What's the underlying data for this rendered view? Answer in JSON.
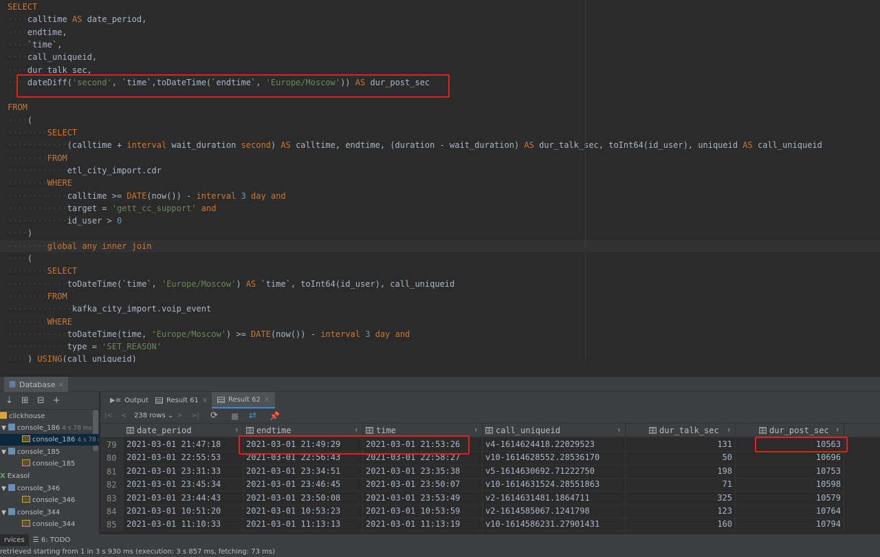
{
  "editor": {
    "lines": [
      [
        {
          "t": "SELECT",
          "c": "kw"
        }
      ],
      [
        {
          "t": "····",
          "c": "ws"
        },
        {
          "t": "calltime ",
          "c": "idt"
        },
        {
          "t": "AS",
          "c": "kw"
        },
        {
          "t": " date_period,",
          "c": "idt"
        }
      ],
      [
        {
          "t": "····",
          "c": "ws"
        },
        {
          "t": "endtime,",
          "c": "idt"
        }
      ],
      [
        {
          "t": "····",
          "c": "ws"
        },
        {
          "t": "`time`,",
          "c": "idt"
        }
      ],
      [
        {
          "t": "····",
          "c": "ws"
        },
        {
          "t": "call_uniqueid,",
          "c": "idt"
        }
      ],
      [
        {
          "t": "····",
          "c": "ws"
        },
        {
          "t": "dur_talk_sec,",
          "c": "idt"
        }
      ],
      [
        {
          "t": "····",
          "c": "ws"
        },
        {
          "t": "dateDiff(",
          "c": "idt"
        },
        {
          "t": "'second'",
          "c": "st"
        },
        {
          "t": ", `time`,toDateTime(`endtime`, ",
          "c": "idt"
        },
        {
          "t": "'Europe/Moscow'",
          "c": "st"
        },
        {
          "t": ")) ",
          "c": "idt"
        },
        {
          "t": "AS",
          "c": "kw"
        },
        {
          "t": " dur_post_sec",
          "c": "idt"
        }
      ],
      [],
      [
        {
          "t": "FROM",
          "c": "kw"
        }
      ],
      [
        {
          "t": "····",
          "c": "ws"
        },
        {
          "t": "(",
          "c": "idt"
        }
      ],
      [
        {
          "t": "········",
          "c": "ws"
        },
        {
          "t": "SELECT",
          "c": "kw"
        }
      ],
      [
        {
          "t": "············",
          "c": "ws"
        },
        {
          "t": "(calltime + ",
          "c": "idt"
        },
        {
          "t": "interval",
          "c": "kw"
        },
        {
          "t": " wait_duration ",
          "c": "idt"
        },
        {
          "t": "second",
          "c": "kw"
        },
        {
          "t": ") ",
          "c": "idt"
        },
        {
          "t": "AS",
          "c": "kw"
        },
        {
          "t": " calltime, endtime, (duration - wait_duration) ",
          "c": "idt"
        },
        {
          "t": "AS",
          "c": "kw"
        },
        {
          "t": " dur_talk_sec, toInt64(id_user), uniqueid ",
          "c": "idt"
        },
        {
          "t": "AS",
          "c": "kw"
        },
        {
          "t": " call_uniqueid",
          "c": "idt"
        }
      ],
      [
        {
          "t": "········",
          "c": "ws"
        },
        {
          "t": "FROM",
          "c": "kw"
        }
      ],
      [
        {
          "t": "············",
          "c": "ws"
        },
        {
          "t": "etl_city_import.cdr",
          "c": "idt"
        }
      ],
      [
        {
          "t": "········",
          "c": "ws"
        },
        {
          "t": "WHERE",
          "c": "kw"
        }
      ],
      [
        {
          "t": "············",
          "c": "ws"
        },
        {
          "t": "calltime >= ",
          "c": "idt"
        },
        {
          "t": "DATE",
          "c": "kw"
        },
        {
          "t": "(now()) - ",
          "c": "idt"
        },
        {
          "t": "interval",
          "c": "kw"
        },
        {
          "t": " ",
          "c": "idt"
        },
        {
          "t": "3",
          "c": "nm"
        },
        {
          "t": " ",
          "c": "idt"
        },
        {
          "t": "day",
          "c": "kw"
        },
        {
          "t": " ",
          "c": "idt"
        },
        {
          "t": "and",
          "c": "kw"
        }
      ],
      [
        {
          "t": "············",
          "c": "ws"
        },
        {
          "t": "target = ",
          "c": "idt"
        },
        {
          "t": "'gett_cc_support'",
          "c": "st"
        },
        {
          "t": " ",
          "c": "idt"
        },
        {
          "t": "and",
          "c": "kw"
        }
      ],
      [
        {
          "t": "············",
          "c": "ws"
        },
        {
          "t": "id_user > ",
          "c": "idt"
        },
        {
          "t": "0",
          "c": "nm"
        }
      ],
      [
        {
          "t": "····",
          "c": "ws"
        },
        {
          "t": ")",
          "c": "idt"
        }
      ],
      [
        {
          "t": "········",
          "c": "ws"
        },
        {
          "t": "global any inner join",
          "c": "kw"
        }
      ],
      [
        {
          "t": "····",
          "c": "ws"
        },
        {
          "t": "(",
          "c": "idt"
        }
      ],
      [
        {
          "t": "········",
          "c": "ws"
        },
        {
          "t": "SELECT",
          "c": "kw"
        }
      ],
      [
        {
          "t": "············",
          "c": "ws"
        },
        {
          "t": "toDateTime(`time`, ",
          "c": "idt"
        },
        {
          "t": "'Europe/Moscow'",
          "c": "st"
        },
        {
          "t": ") ",
          "c": "idt"
        },
        {
          "t": "AS",
          "c": "kw"
        },
        {
          "t": " `time`, toInt64(id_user), call_uniqueid",
          "c": "idt"
        }
      ],
      [
        {
          "t": "········",
          "c": "ws"
        },
        {
          "t": "FROM",
          "c": "kw"
        }
      ],
      [
        {
          "t": "·············",
          "c": "ws"
        },
        {
          "t": "kafka_city_import.voip_event",
          "c": "idt"
        }
      ],
      [
        {
          "t": "········",
          "c": "ws"
        },
        {
          "t": "WHERE",
          "c": "kw"
        }
      ],
      [
        {
          "t": "············",
          "c": "ws"
        },
        {
          "t": "toDateTime(time, ",
          "c": "idt"
        },
        {
          "t": "'Europe/Moscow'",
          "c": "st"
        },
        {
          "t": ") >= ",
          "c": "idt"
        },
        {
          "t": "DATE",
          "c": "kw"
        },
        {
          "t": "(now()) - ",
          "c": "idt"
        },
        {
          "t": "interval",
          "c": "kw"
        },
        {
          "t": " ",
          "c": "idt"
        },
        {
          "t": "3",
          "c": "nm"
        },
        {
          "t": " ",
          "c": "idt"
        },
        {
          "t": "day",
          "c": "kw"
        },
        {
          "t": " ",
          "c": "idt"
        },
        {
          "t": "and",
          "c": "kw"
        }
      ],
      [
        {
          "t": "············",
          "c": "ws"
        },
        {
          "t": "type = ",
          "c": "idt"
        },
        {
          "t": "'SET_REASON'",
          "c": "st"
        }
      ],
      [
        {
          "t": "····",
          "c": "ws"
        },
        {
          "t": ") ",
          "c": "idt"
        },
        {
          "t": "USING",
          "c": "kw"
        },
        {
          "t": "(call_uniqueid)",
          "c": "idt"
        }
      ]
    ]
  },
  "db_panel": {
    "title": "Database",
    "close": "×"
  },
  "sidebar": {
    "items": [
      {
        "label": "clickhouse",
        "meta": ""
      },
      {
        "label": "console_186",
        "meta": "4 s 78 ms"
      },
      {
        "label": "console_186",
        "meta": "4 s 78 m"
      },
      {
        "label": "console_185",
        "meta": ""
      },
      {
        "label": "console_185",
        "meta": ""
      },
      {
        "label": "Exasol",
        "meta": ""
      },
      {
        "label": "console_346",
        "meta": ""
      },
      {
        "label": "console_346",
        "meta": ""
      },
      {
        "label": "console_344",
        "meta": ""
      },
      {
        "label": "console_344",
        "meta": ""
      }
    ]
  },
  "result_tabs": [
    {
      "label": "Output",
      "close": ""
    },
    {
      "label": "Result 61",
      "close": "×"
    },
    {
      "label": "Result 62",
      "close": "×"
    }
  ],
  "result_toolbar": {
    "rows_label": "238 rows",
    "rows_chevron": "⌄"
  },
  "table": {
    "columns": [
      "date_period",
      "endtime",
      "time",
      "call_uniqueid",
      "dur_talk_sec",
      "dur_post_sec"
    ],
    "rows": [
      {
        "n": "79",
        "cells": [
          "2021-03-01 21:47:18",
          "2021-03-01 21:49:29",
          "2021-03-01 21:53:26",
          "v4-1614624418.22029523",
          "131",
          "10563"
        ]
      },
      {
        "n": "80",
        "cells": [
          "2021-03-01 22:55:53",
          "2021-03-01 22:56:43",
          "2021-03-01 22:58:27",
          "v10-1614628552.28536170",
          "50",
          "10696"
        ]
      },
      {
        "n": "81",
        "cells": [
          "2021-03-01 23:31:33",
          "2021-03-01 23:34:51",
          "2021-03-01 23:35:38",
          "v5-1614630692.71222750",
          "198",
          "10753"
        ]
      },
      {
        "n": "82",
        "cells": [
          "2021-03-01 23:45:34",
          "2021-03-01 23:46:45",
          "2021-03-01 23:50:07",
          "v10-1614631524.28551863",
          "71",
          "10598"
        ]
      },
      {
        "n": "83",
        "cells": [
          "2021-03-01 23:44:43",
          "2021-03-01 23:50:08",
          "2021-03-01 23:53:49",
          "v2-1614631481.1864711",
          "325",
          "10579"
        ]
      },
      {
        "n": "84",
        "cells": [
          "2021-03-01 10:51:20",
          "2021-03-01 10:53:23",
          "2021-03-01 10:53:59",
          "v2-1614585067.1241798",
          "123",
          "10764"
        ]
      },
      {
        "n": "85",
        "cells": [
          "2021-03-01 11:10:33",
          "2021-03-01 11:13:13",
          "2021-03-01 11:13:19",
          "v10-1614586231.27901431",
          "160",
          "10794"
        ]
      }
    ]
  },
  "statusbar": {
    "tabs": [
      {
        "label": "rvices"
      },
      {
        "label": "6: TODO"
      }
    ],
    "message": "retrieved starting from 1 in 3 s 930 ms (execution: 3 s 857 ms, fetching: 73 ms)"
  },
  "colors": {
    "keyword": "#cc7832",
    "string": "#6a8759",
    "number": "#6897bb",
    "highlight": "#e81e1e",
    "accent": "#4a88c7"
  }
}
